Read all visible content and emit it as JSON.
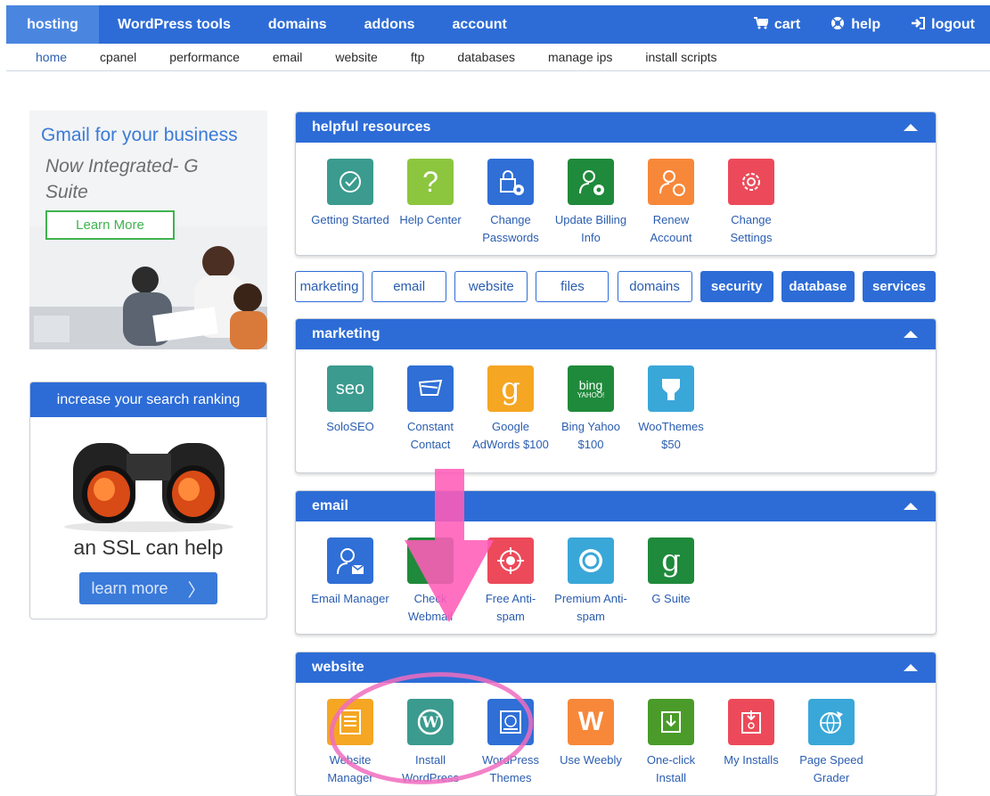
{
  "nav": {
    "items": [
      {
        "label": "hosting",
        "active": true
      },
      {
        "label": "WordPress tools"
      },
      {
        "label": "domains"
      },
      {
        "label": "addons"
      },
      {
        "label": "account"
      }
    ],
    "right": [
      {
        "label": "cart",
        "icon": "cart-icon"
      },
      {
        "label": "help",
        "icon": "lifebuoy-icon"
      },
      {
        "label": "logout",
        "icon": "logout-icon"
      }
    ]
  },
  "subnav": [
    "home",
    "cpanel",
    "performance",
    "email",
    "website",
    "ftp",
    "databases",
    "manage ips",
    "install scripts"
  ],
  "ad_gsuite": {
    "title": "Gmail for your business",
    "subtitle": "Now Integrated- G Suite",
    "button": "Learn More"
  },
  "ad_ssl": {
    "header": "increase your search ranking",
    "text": "an SSL can help",
    "button": "learn more",
    "button_icon": "chevron-right-icon"
  },
  "helpful": {
    "title": "helpful resources",
    "tiles": [
      {
        "label": "Getting Started",
        "icon": "checkmark-icon",
        "color": "#3a9b8e"
      },
      {
        "label": "Help Center",
        "icon": "question-icon",
        "color": "#8cc63f"
      },
      {
        "label": "Change Passwords",
        "icon": "lock-gear-icon",
        "color": "#2f6fd6"
      },
      {
        "label": "Update Billing Info",
        "icon": "user-gear-icon",
        "color": "#1f8a3b"
      },
      {
        "label": "Renew Account",
        "icon": "user-refresh-icon",
        "color": "#f7883a"
      },
      {
        "label": "Change Settings",
        "icon": "gear-icon",
        "color": "#ec4a5a"
      }
    ]
  },
  "filters": [
    "marketing",
    "email",
    "website",
    "files",
    "domains",
    "security",
    "database",
    "services"
  ],
  "marketing": {
    "title": "marketing",
    "tiles": [
      {
        "label": "SoloSEO",
        "icon": "seo-icon",
        "glyph": "seo",
        "color": "#3a9b8e"
      },
      {
        "label": "Constant Contact",
        "icon": "envelope-icon",
        "color": "#2f6fd6"
      },
      {
        "label": "Google AdWords $100",
        "icon": "google-g-icon",
        "glyph": "g",
        "color": "#f5a623"
      },
      {
        "label": "Bing Yahoo $100",
        "icon": "bing-yahoo-icon",
        "glyph": "bing",
        "glyph2": "YAHOO!",
        "color": "#1f8a3b"
      },
      {
        "label": "WooThemes $50",
        "icon": "woothemes-icon",
        "color": "#3aa7d9"
      }
    ]
  },
  "email": {
    "title": "email",
    "tiles": [
      {
        "label": "Email Manager",
        "icon": "user-envelope-icon",
        "color": "#2f6fd6"
      },
      {
        "label": "Check Webmail",
        "icon": "webmail-icon",
        "color": "#1f8a3b"
      },
      {
        "label": "Free Anti-spam",
        "icon": "target-icon",
        "color": "#ec4a5a"
      },
      {
        "label": "Premium Anti-spam",
        "icon": "shield-circle-icon",
        "color": "#3aa7d9"
      },
      {
        "label": "G Suite",
        "icon": "google-g-icon",
        "glyph": "g",
        "color": "#1f8a3b"
      }
    ]
  },
  "website": {
    "title": "website",
    "tiles": [
      {
        "label": "Website Manager",
        "icon": "document-icon",
        "color": "#f5a623"
      },
      {
        "label": "Install WordPress",
        "icon": "wordpress-icon",
        "color": "#3a9b8e"
      },
      {
        "label": "WordPress Themes",
        "icon": "wordpress-themes-icon",
        "color": "#2f6fd6"
      },
      {
        "label": "Use Weebly",
        "icon": "weebly-icon",
        "glyph": "W",
        "color": "#f7883a"
      },
      {
        "label": "One-click Install",
        "icon": "download-icon",
        "color": "#4a9b2a"
      },
      {
        "label": "My Installs",
        "icon": "installs-icon",
        "color": "#ec4a5a"
      },
      {
        "label": "Page Speed Grader",
        "icon": "globe-icon",
        "color": "#3aa7d9"
      }
    ]
  },
  "annotations": {
    "arrow_color": "#ff5cb8",
    "circle_color": "#f06cc0"
  }
}
